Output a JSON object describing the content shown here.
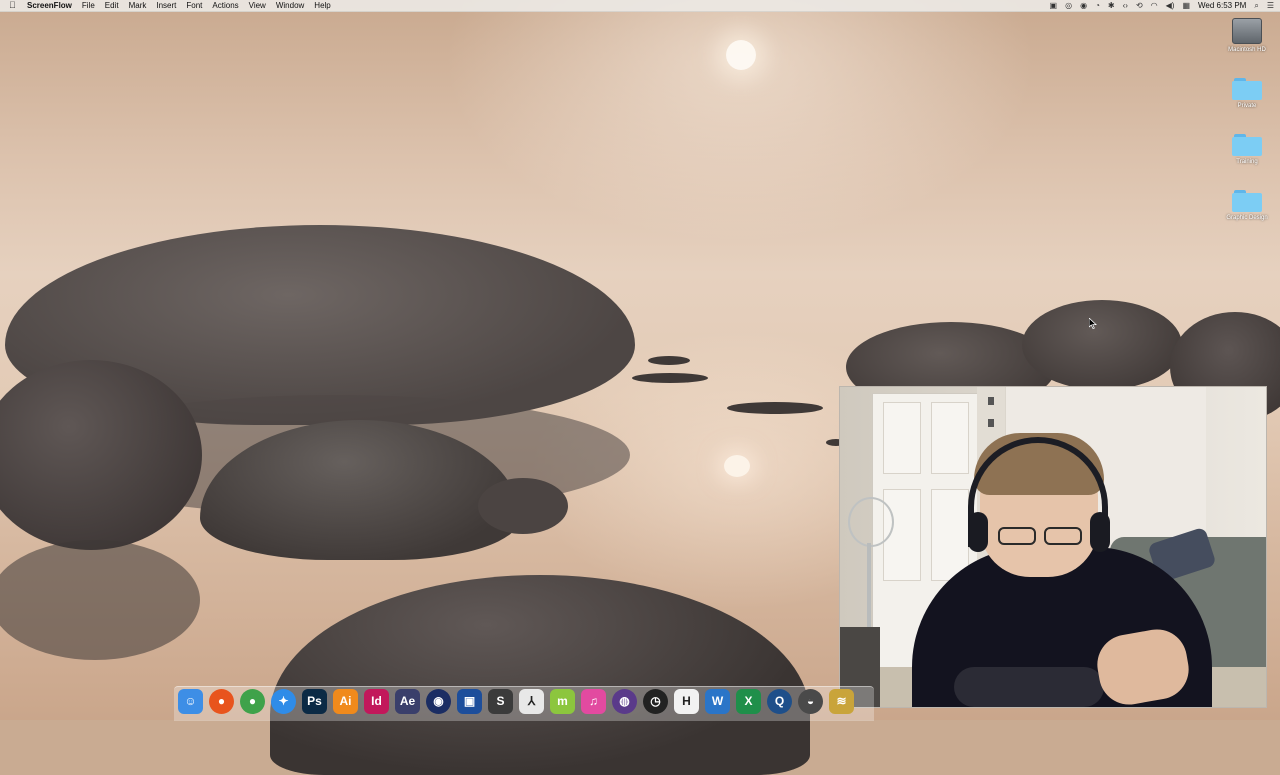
{
  "menubar": {
    "app_name": "ScreenFlow",
    "items": [
      "File",
      "Edit",
      "Mark",
      "Insert",
      "Font",
      "Actions",
      "View",
      "Window",
      "Help"
    ],
    "clock": "Wed 6:53 PM",
    "status_icons": [
      "screenflow-record-icon",
      "sync-icon",
      "creative-cloud-icon",
      "clock-icon",
      "wifi-icon",
      "volume-icon",
      "keyboard-icon",
      "spotlight-icon",
      "notification-center-icon"
    ]
  },
  "desktop": {
    "icons": [
      {
        "label": "Macintosh HD",
        "kind": "drive"
      },
      {
        "label": "Private",
        "kind": "folder"
      },
      {
        "label": "Training",
        "kind": "folder"
      },
      {
        "label": "Graphic Design",
        "kind": "folder"
      }
    ]
  },
  "dock": {
    "apps": [
      {
        "name": "finder",
        "glyph": "☺",
        "bg": "#3d8ee6"
      },
      {
        "name": "firefox",
        "glyph": "●",
        "bg": "#e8541d"
      },
      {
        "name": "chrome",
        "glyph": "●",
        "bg": "#3fa24a"
      },
      {
        "name": "safari",
        "glyph": "✦",
        "bg": "#2f8ce8"
      },
      {
        "name": "photoshop",
        "glyph": "Ps",
        "bg": "#0b2a45"
      },
      {
        "name": "illustrator",
        "glyph": "Ai",
        "bg": "#f08a1c"
      },
      {
        "name": "indesign",
        "glyph": "Id",
        "bg": "#c2185b"
      },
      {
        "name": "after-effects",
        "glyph": "Ae",
        "bg": "#3a3f6b"
      },
      {
        "name": "cinema4d",
        "glyph": "◉",
        "bg": "#1b2d63"
      },
      {
        "name": "screenflow",
        "glyph": "▣",
        "bg": "#1d4e9b"
      },
      {
        "name": "sublime-text",
        "glyph": "S",
        "bg": "#3b3b3b"
      },
      {
        "name": "acrobat",
        "glyph": "⅄",
        "bg": "#e8e8e8"
      },
      {
        "name": "mindnode",
        "glyph": "m",
        "bg": "#8cc63e"
      },
      {
        "name": "itunes",
        "glyph": "♫",
        "bg": "#e24aa0"
      },
      {
        "name": "github",
        "glyph": "◍",
        "bg": "#5a3a8a"
      },
      {
        "name": "clock-app",
        "glyph": "◷",
        "bg": "#222222"
      },
      {
        "name": "hemingway",
        "glyph": "H",
        "bg": "#f2f2f2"
      },
      {
        "name": "word",
        "glyph": "W",
        "bg": "#2a75c8"
      },
      {
        "name": "excel",
        "glyph": "X",
        "bg": "#1f8f4a"
      },
      {
        "name": "quicktime",
        "glyph": "Q",
        "bg": "#1e4f8a"
      },
      {
        "name": "sequel",
        "glyph": "◒",
        "bg": "#4a4a4a"
      },
      {
        "name": "coins",
        "glyph": "≋",
        "bg": "#c9a43a"
      }
    ]
  },
  "webcam": {
    "visible": true
  },
  "colors": {
    "menubar_bg": "#ece8e4",
    "folder_blue": "#7ccdf4",
    "rock": "#5b5452"
  }
}
